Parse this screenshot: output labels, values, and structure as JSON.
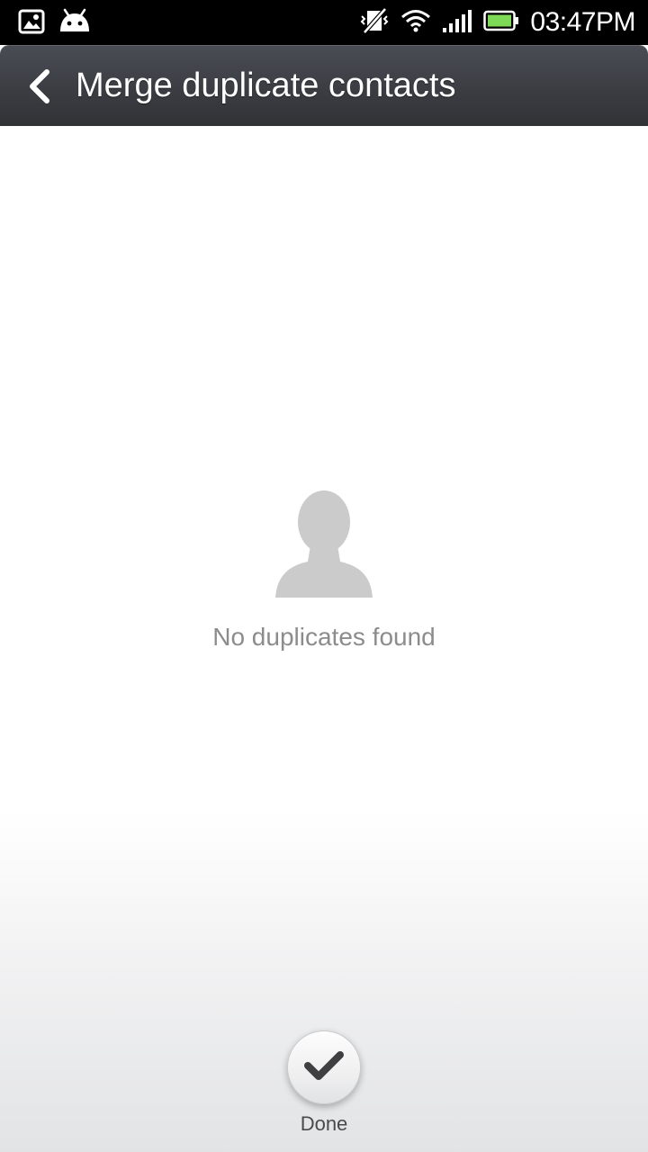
{
  "status_bar": {
    "time": "03:47PM",
    "icons": [
      "image-icon",
      "android-icon",
      "vibrate-muted-icon",
      "wifi-icon",
      "signal-icon",
      "battery-icon"
    ],
    "battery_color": "#7ed957"
  },
  "header": {
    "title": "Merge duplicate contacts",
    "back_icon": "chevron-left-icon"
  },
  "empty_state": {
    "icon": "person-silhouette-icon",
    "message": "No duplicates found"
  },
  "footer": {
    "done_label": "Done",
    "done_icon": "checkmark-icon"
  },
  "colors": {
    "action_bar": "#3b3d43",
    "empty_icon": "#cbcbcb",
    "empty_text": "#8c8c8c"
  }
}
